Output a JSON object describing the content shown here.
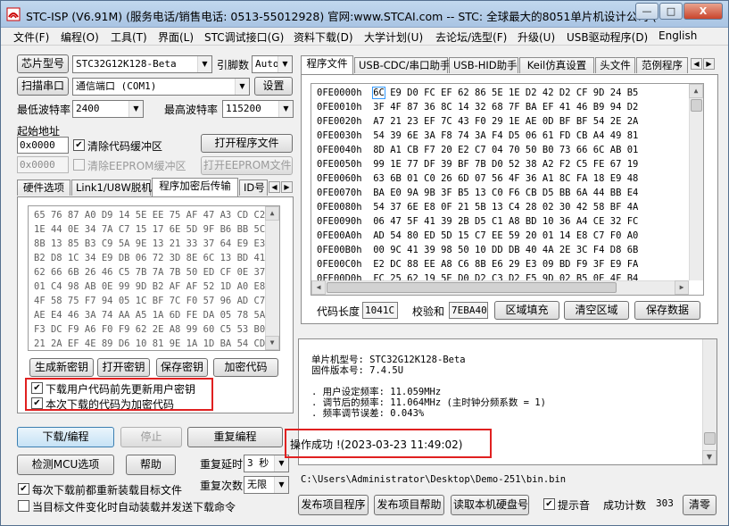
{
  "window": {
    "title": "STC-ISP (V6.91M) (服务电话/销售电话: 0513-55012928) 官网:www.STCAI.com  -- STC: 全球最大的8051单片机设计公司 (",
    "minimize": "—",
    "maximize": "□",
    "close": "X"
  },
  "menu": [
    "文件(F)",
    "编程(O)",
    "工具(T)",
    "界面(L)",
    "STC调试接口(G)",
    "资料下载(D)",
    "大学计划(U)",
    "去论坛/选型(F)",
    "升级(U)",
    "USB驱动程序(D)",
    "English"
  ],
  "left": {
    "chip_type_button": "芯片型号",
    "chip_type_value": "STC32G12K128-Beta",
    "pins_label": "引脚数",
    "pins_value": "Auto",
    "scan_port_button": "扫描串口",
    "port_value": "通信端口 (COM1)",
    "settings_button": "设置",
    "min_baud_label": "最低波特率",
    "min_baud_value": "2400",
    "max_baud_label": "最高波特率",
    "max_baud_value": "115200",
    "start_addr_label": "起始地址",
    "code_addr": "0x0000",
    "clear_code_label": "清除代码缓冲区",
    "open_program_button": "打开程序文件",
    "eeprom_addr": "0x0000",
    "clear_eeprom_label": "清除EEPROM缓冲区",
    "open_eeprom_button": "打开EEPROM文件",
    "tabs": [
      "硬件选项",
      "Link1/U8W脱机",
      "程序加密后传输",
      "ID号"
    ],
    "tab_scroll_left": "◀",
    "tab_scroll_right": "▶",
    "enc_hex": [
      "65 76 87 A0 D9 14 5E EE 75 AF 47 A3 CD C2 E(",
      "1E 44 0E 34 7A C7 15 17 6E 5D 9F B6 BB 5C 1'",
      "8B 13 85 B3 C9 5A 9E 13 21 33 37 64 E9 E3 F'",
      "B2 D8 1C 34 E9 DB 06 72 3D 8E 6C 13 BD 41 4'",
      "62 66 6B 26 46 C5 7B 7A 7B 50 ED CF 0E 37 9(",
      "01 C4 98 AB 0E 99 9D B2 AF AF 52 1D A0 E8 4'",
      "4F 58 75 F7 94 05 1C BF 7C F0 57 96 AD C7 9'",
      "AE E4 46 3A 74 AA A5 1A 6D FE DA 05 78 5A 9(",
      "F3 DC F9 A6 F0 F9 62 2E A8 99 60 C5 53 B0 E(",
      "21 2A EF 4E 89 D6 10 81 9E 1A 1D BA 54 CD B'"
    ],
    "gen_key_button": "生成新密钥",
    "open_key_button": "打开密钥",
    "save_key_button": "保存密钥",
    "encrypt_button": "加密代码",
    "update_key_label": "下载用户代码前先更新用户密钥",
    "encrypted_label": "本次下载的代码为加密代码",
    "download_button": "下载/编程",
    "stop_button": "停止",
    "reprogram_button": "重复编程",
    "check_mcu_button": "检测MCU选项",
    "help_button": "帮助",
    "repeat_delay_label": "重复延时",
    "repeat_delay_value": "3 秒",
    "repeat_count_label": "重复次数",
    "repeat_count_value": "无限",
    "reload_label": "每次下载前都重新装载目标文件",
    "auto_load_label": "当目标文件变化时自动装载并发送下载命令"
  },
  "right": {
    "tabs": [
      "程序文件",
      "USB-CDC/串口助手",
      "USB-HID助手",
      "Keil仿真设置",
      "头文件",
      "范例程序"
    ],
    "hex_rows": [
      {
        "addr": "0FE0000h",
        "first": "6C",
        "rest": " E9 D0 FC EF 62 86 5E 1E D2 42 D2 CF 9D 24 B5"
      },
      {
        "addr": "0FE0010h",
        "first": "3F",
        "rest": " 4F 87 36 8C 14 32 68 7F BA EF 41 46 B9 94 D2"
      },
      {
        "addr": "0FE0020h",
        "first": "A7",
        "rest": " 21 23 EF 7C 43 F0 29 1E AE 0D BF BF 54 2E 2A"
      },
      {
        "addr": "0FE0030h",
        "first": "54",
        "rest": " 39 6E 3A F8 74 3A F4 D5 06 61 FD CB A4 49 81"
      },
      {
        "addr": "0FE0040h",
        "first": "8D",
        "rest": " A1 CB F7 20 E2 C7 04 70 50 B0 73 66 6C AB 01"
      },
      {
        "addr": "0FE0050h",
        "first": "99",
        "rest": " 1E 77 DF 39 BF 7B D0 52 38 A2 F2 C5 FE 67 19"
      },
      {
        "addr": "0FE0060h",
        "first": "63",
        "rest": " 6B 01 C0 26 6D 07 56 4F 36 A1 8C FA 18 E9 48"
      },
      {
        "addr": "0FE0070h",
        "first": "BA",
        "rest": " E0 9A 9B 3F B5 13 C0 F6 CB D5 BB 6A 44 BB E4"
      },
      {
        "addr": "0FE0080h",
        "first": "54",
        "rest": " 37 6E E8 0F 21 5B 13 C4 28 02 30 42 58 BF 4A"
      },
      {
        "addr": "0FE0090h",
        "first": "06",
        "rest": " 47 5F 41 39 2B D5 C1 A8 BD 10 36 A4 CE 32 FC"
      },
      {
        "addr": "0FE00A0h",
        "first": "AD",
        "rest": " 54 80 ED 5D 15 C7 EE 59 20 01 14 E8 C7 F0 A0"
      },
      {
        "addr": "0FE00B0h",
        "first": "00",
        "rest": " 9C 41 39 98 50 10 DD DB 40 4A 2E 3C F4 D8 6B"
      },
      {
        "addr": "0FE00C0h",
        "first": "E2",
        "rest": " DC 88 EE A8 C6 8B E6 29 E3 09 BD F9 3F E9 FA"
      },
      {
        "addr": "0FE00D0h",
        "first": "FC",
        "rest": " 25 62 19 5E D0 D2 C3 D2 F5 9D 02 B5 0E 4F B4"
      }
    ],
    "code_length_label": "代码长度",
    "code_length_value": "1041C",
    "checksum_label": "校验和",
    "checksum_value": "7EBA40",
    "fill_button": "区域填充",
    "clear_button": "清空区域",
    "save_data_button": "保存数据",
    "info_lines": [
      "单片机型号: STC32G12K128-Beta",
      "固件版本号: 7.4.5U",
      ". 用户设定频率: 11.059MHz",
      ". 调节后的频率: 11.064MHz (主时钟分频系数 = 1)",
      ". 频率调节误差: 0.043%"
    ],
    "status_msg": "操作成功 !(2023-03-23 11:49:02)",
    "file_path": "C:\\Users\\Administrator\\Desktop\\Demo-251\\bin.bin",
    "publish_prog_button": "发布项目程序",
    "publish_help_button": "发布项目帮助",
    "read_disk_button": "读取本机硬盘号",
    "beep_label": "提示音",
    "success_label": "成功计数",
    "success_count": "303",
    "clear_count_button": "清零"
  },
  "colors": {
    "highlight": "#e02020",
    "selection": "#3399ff"
  }
}
